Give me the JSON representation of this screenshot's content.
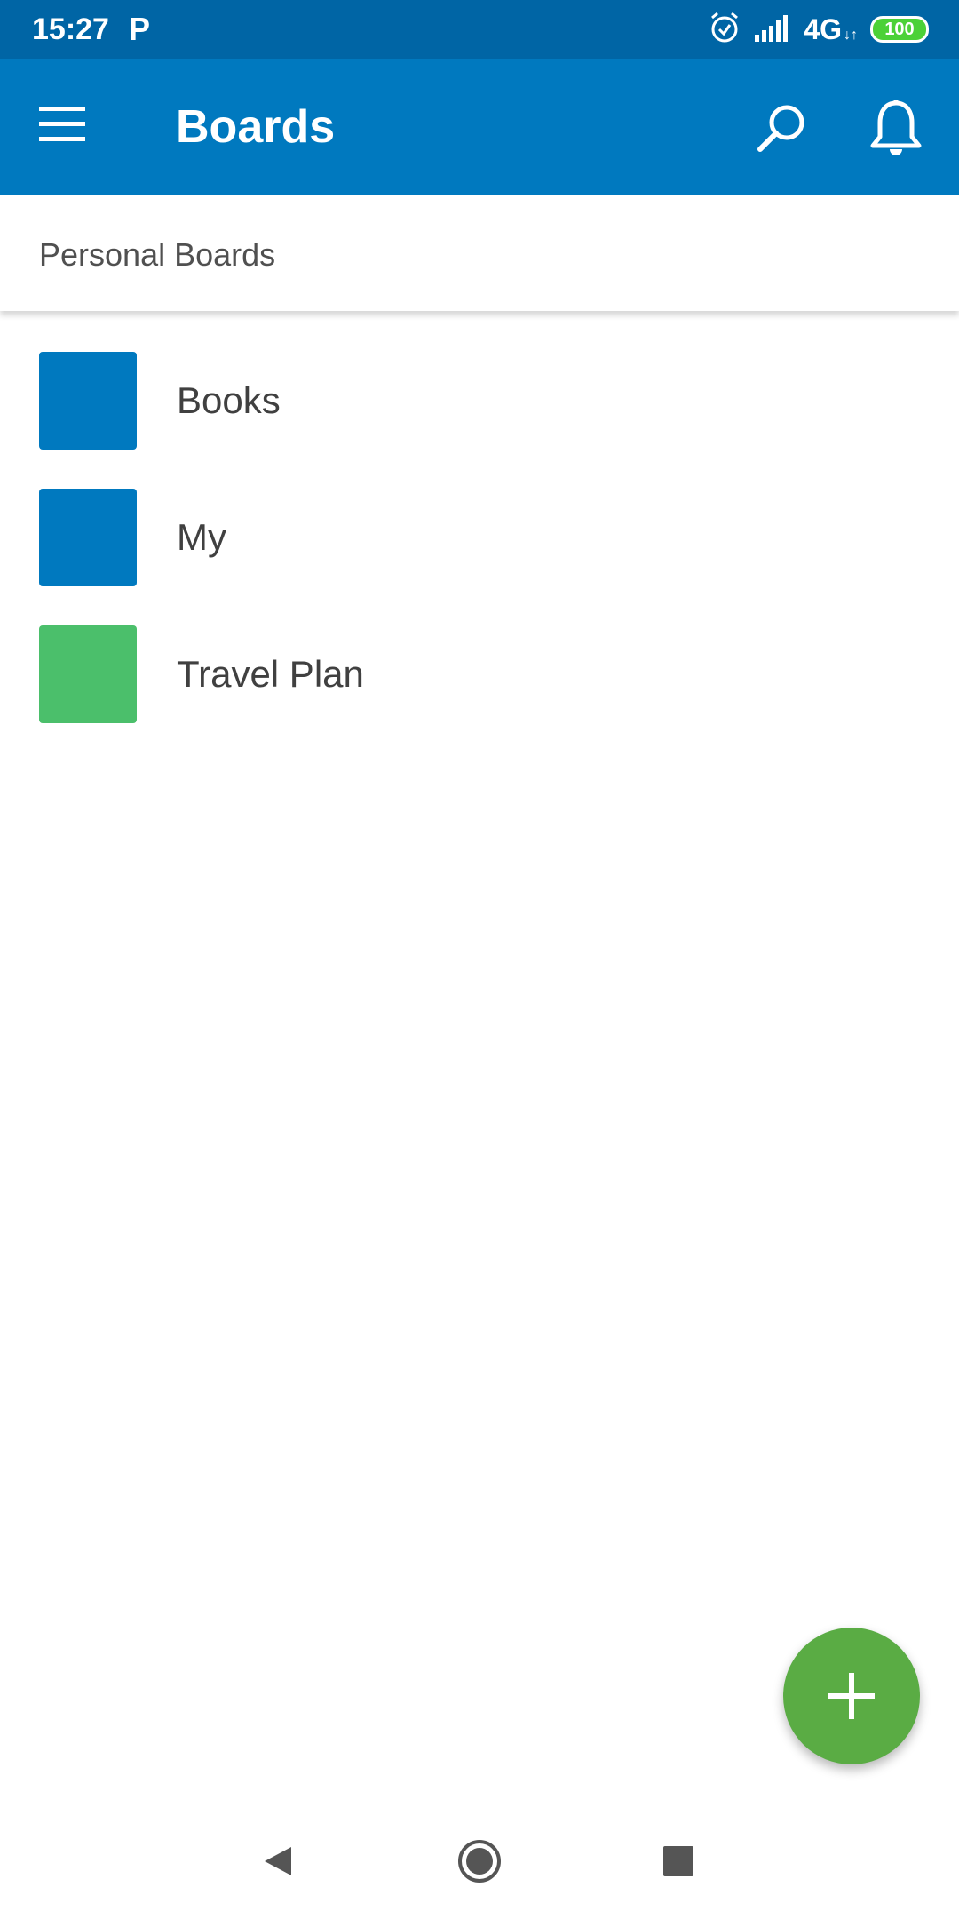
{
  "status_bar": {
    "time": "15:27",
    "p_indicator": "P",
    "network": "4G",
    "network_sub": "↓↑",
    "battery": "100",
    "icons": [
      "alarm-icon",
      "signal-icon",
      "battery-icon"
    ]
  },
  "app_bar": {
    "title": "Boards",
    "icons": [
      "menu-icon",
      "search-icon",
      "bell-icon"
    ],
    "color": "#0079bf"
  },
  "section": {
    "title": "Personal Boards"
  },
  "boards": [
    {
      "name": "Books",
      "color": "#0079bf"
    },
    {
      "name": "My",
      "color": "#0079bf"
    },
    {
      "name": "Travel Plan",
      "color": "#4bbf6b"
    }
  ],
  "fab": {
    "icon": "plus-icon",
    "color": "#5aac44"
  },
  "nav_bar": {
    "icons": [
      "back-icon",
      "home-icon",
      "recents-icon"
    ]
  }
}
